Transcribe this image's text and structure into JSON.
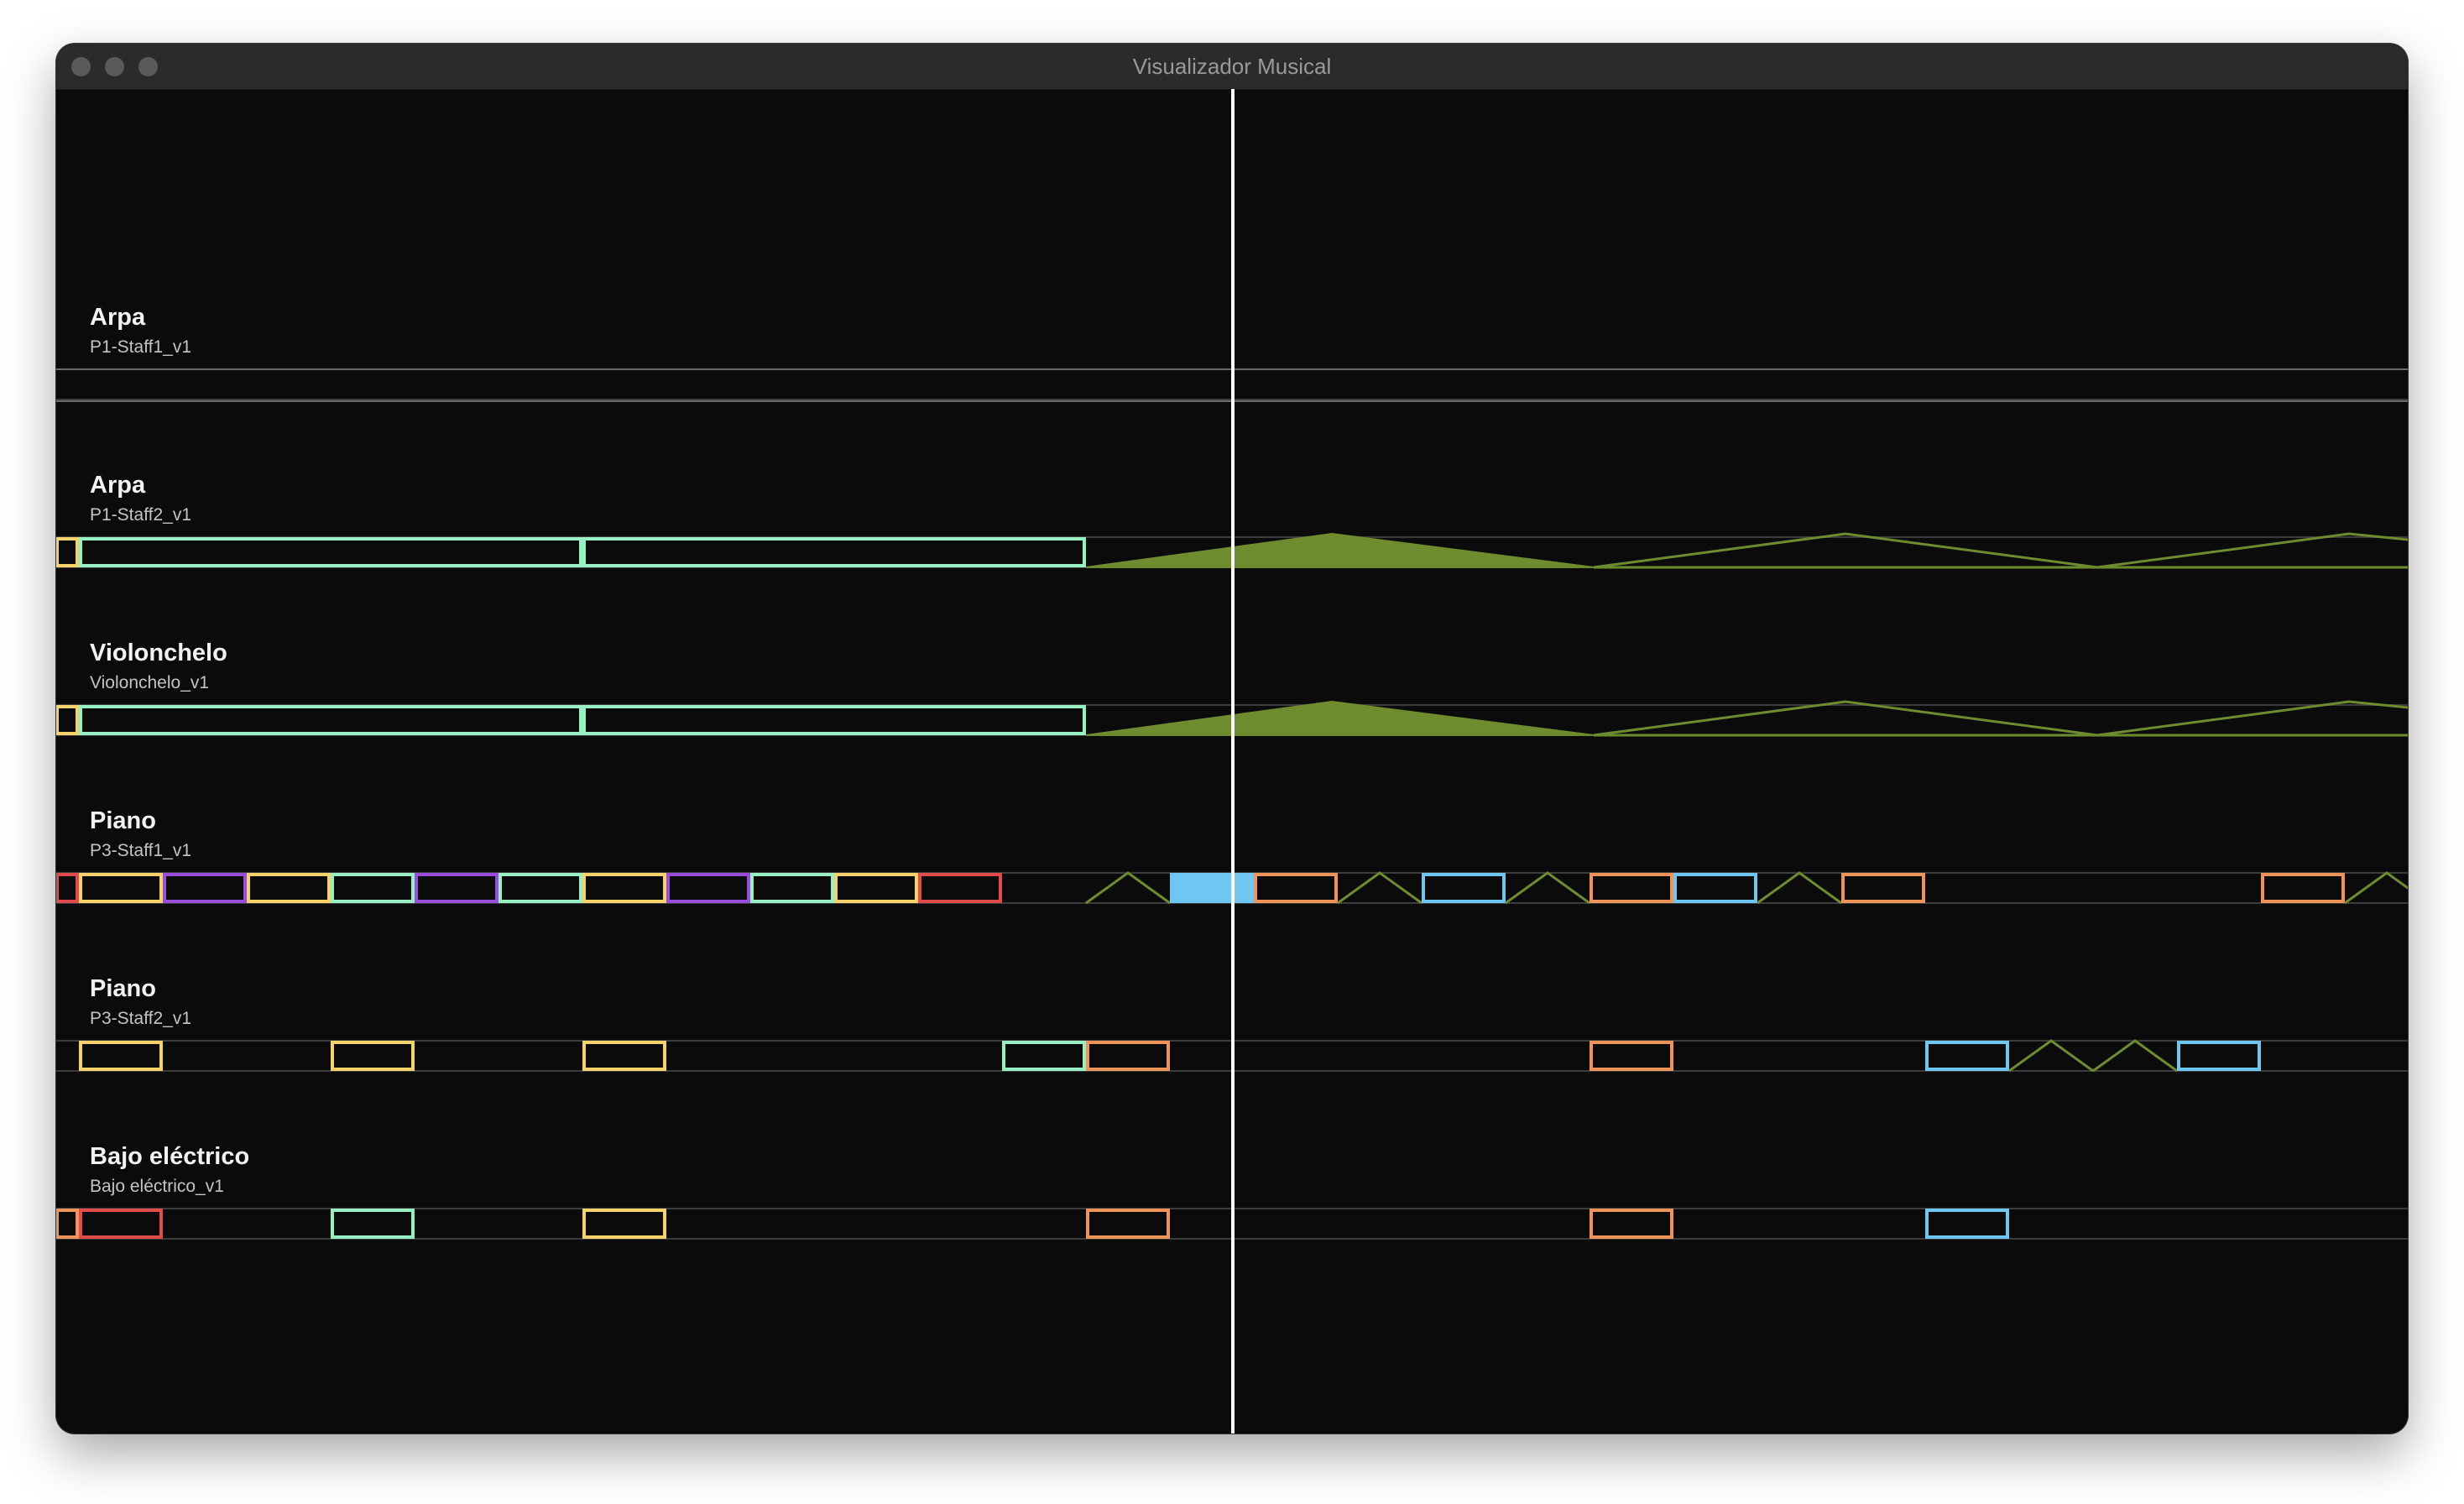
{
  "window": {
    "title": "Visualizador Musical",
    "traffic_lights": [
      "close",
      "minimize",
      "zoom"
    ]
  },
  "colors": {
    "background": "#0b0b0b",
    "lane_line": "#3c3c3c",
    "separator": "#6a6a6a",
    "playhead": "#ffffff",
    "green": "#98f0c2",
    "yellow": "#f6d36a",
    "purple": "#9a4ddd",
    "red": "#e14b4b",
    "orange": "#f0955a",
    "blue": "#6fc6f0",
    "dynamics": "#6e8c2e"
  },
  "tracks": [
    {
      "name": "Arpa",
      "staff": "P1-Staff1_v1"
    },
    {
      "name": "Arpa",
      "staff": "P1-Staff2_v1"
    },
    {
      "name": "Violonchelo",
      "staff": "Violonchelo_v1"
    },
    {
      "name": "Piano",
      "staff": "P3-Staff1_v1"
    },
    {
      "name": "Piano",
      "staff": "P3-Staff2_v1"
    },
    {
      "name": "Bajo eléctrico",
      "staff": "Bajo eléctrico_v1"
    }
  ]
}
